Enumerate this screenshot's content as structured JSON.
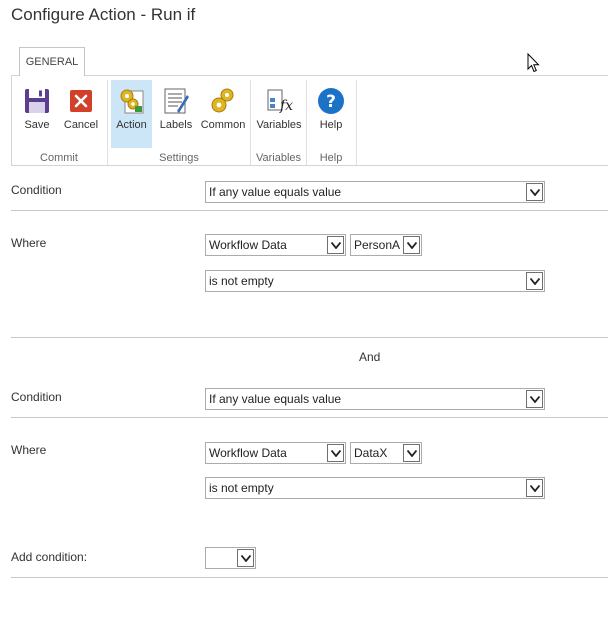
{
  "window": {
    "title": "Configure Action - Run if"
  },
  "ribbon": {
    "tab": "GENERAL",
    "buttons": {
      "save": "Save",
      "cancel": "Cancel",
      "action": "Action",
      "labels": "Labels",
      "common": "Common",
      "variables": "Variables",
      "help": "Help"
    },
    "groups": {
      "commit": "Commit",
      "settings": "Settings",
      "variables": "Variables",
      "help": "Help"
    }
  },
  "form": {
    "block1": {
      "condition_label": "Condition",
      "condition_value": "If any value equals value",
      "where_label": "Where",
      "source_value": "Workflow Data",
      "field_value": "PersonA",
      "operator_value": "is not empty"
    },
    "joiner": "And",
    "block2": {
      "condition_label": "Condition",
      "condition_value": "If any value equals value",
      "where_label": "Where",
      "source_value": "Workflow Data",
      "field_value": "DataX",
      "operator_value": "is not empty"
    },
    "add_condition": {
      "label": "Add condition:",
      "value": ""
    }
  },
  "colors": {
    "active_button_bg": "#cde6f7",
    "help_blue": "#1a73c6",
    "cancel_red": "#d2402c",
    "save_purple": "#5b3f8c"
  }
}
